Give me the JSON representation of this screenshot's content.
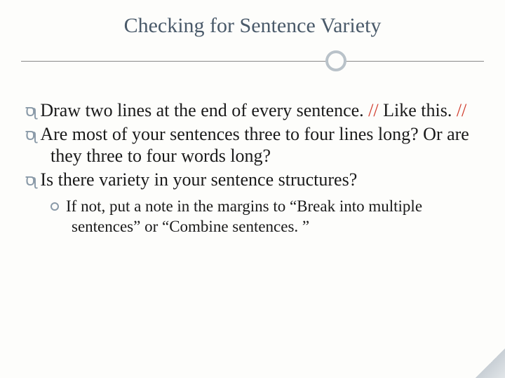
{
  "title": "Checking for Sentence Variety",
  "bullets": [
    {
      "pre": "Draw two lines at the end of every sentence. ",
      "red1": "//",
      "mid": " Like this. ",
      "red2": "//"
    },
    {
      "text": "Are most of your sentences three to four lines long? Or are they three to four words long?"
    },
    {
      "text": "Is there variety in your sentence structures?"
    }
  ],
  "sub": {
    "text": "If not, put a note in the margins to “Break into multiple sentences” or “Combine sentences. ”"
  }
}
